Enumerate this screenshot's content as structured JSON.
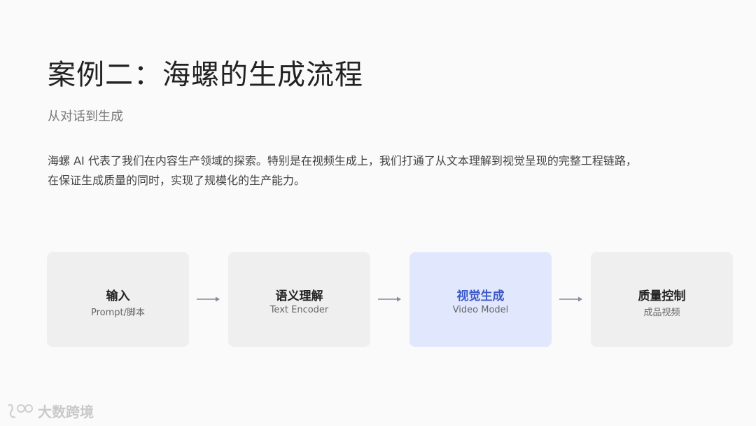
{
  "header": {
    "title": "案例二：海螺的生成流程",
    "subtitle": "从对话到生成"
  },
  "description": {
    "line1": "海螺 AI 代表了我们在内容生产领域的探索。特别是在视频生成上，我们打通了从文本理解到视觉呈现的完整工程链路，",
    "line2": "在保证生成质量的同时，实现了规模化的生产能力。"
  },
  "flow": {
    "steps": [
      {
        "name": "输入",
        "sub": "Prompt/脚本"
      },
      {
        "name": "语义理解",
        "sub": "Text Encoder"
      },
      {
        "name": "视觉生成",
        "sub": "Video Model"
      },
      {
        "name": "质量控制",
        "sub": "成品视频"
      }
    ],
    "active_color": "#3d59c7",
    "active_bg": "#e1e7fd",
    "box_bg": "#efefef",
    "arrow_color": "#8a8a9a"
  },
  "watermark": {
    "text": "大数跨境"
  }
}
